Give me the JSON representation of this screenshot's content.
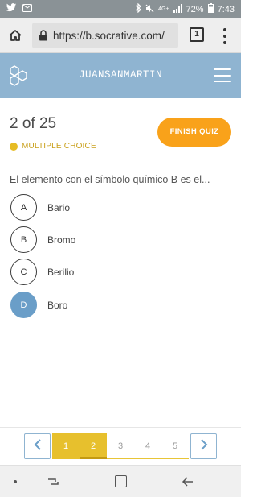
{
  "status_bar": {
    "battery": "72%",
    "time": "7:43",
    "network": "4G+"
  },
  "browser": {
    "url": "https://b.socrative.com/",
    "tab_count": "1"
  },
  "header": {
    "username": "JUANSANMARTIN"
  },
  "quiz": {
    "progress": "2 of 25",
    "question_type": "MULTIPLE CHOICE",
    "finish_label": "FINISH QUIZ",
    "question": "El elemento con el símbolo químico B es el...",
    "answers": [
      {
        "letter": "A",
        "text": "Bario"
      },
      {
        "letter": "B",
        "text": "Bromo"
      },
      {
        "letter": "C",
        "text": "Berilio"
      },
      {
        "letter": "D",
        "text": "Boro"
      }
    ],
    "selected_answer": "D"
  },
  "pagination": {
    "pages": [
      "1",
      "2",
      "3",
      "4",
      "5"
    ],
    "current": "2"
  },
  "colors": {
    "header_blue": "#8fb4d1",
    "accent_orange": "#f9a21a",
    "accent_yellow": "#e7c02d",
    "selected_blue": "#6a9ec8"
  }
}
